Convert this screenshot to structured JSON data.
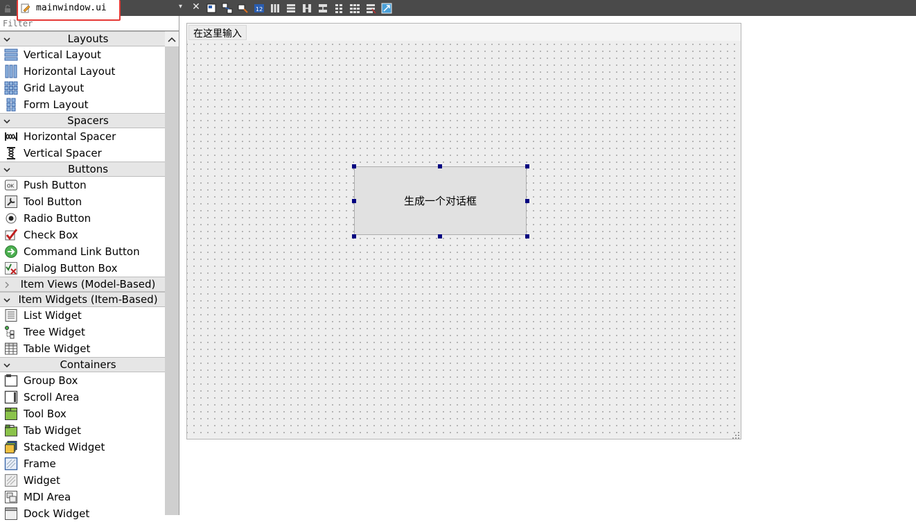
{
  "toolbar": {
    "file_tab": "mainwindow.ui",
    "tab_dropdown": "▾",
    "close_glyph": "✕",
    "tool_icons": [
      "edit-widgets-icon",
      "edit-signals-icon",
      "edit-buddies-icon",
      "edit-tab-order-icon",
      "layout-horizontal-icon",
      "layout-vertical-icon",
      "layout-h-splitter-icon",
      "layout-v-splitter-icon",
      "layout-form-icon",
      "layout-grid-icon",
      "break-layout-icon",
      "adjust-size-icon"
    ]
  },
  "filter": {
    "placeholder": "Filter"
  },
  "widget_box": {
    "categories": [
      {
        "title": "Layouts",
        "expanded": true,
        "items": [
          "Vertical Layout",
          "Horizontal Layout",
          "Grid Layout",
          "Form Layout"
        ]
      },
      {
        "title": "Spacers",
        "expanded": true,
        "items": [
          "Horizontal Spacer",
          "Vertical Spacer"
        ]
      },
      {
        "title": "Buttons",
        "expanded": true,
        "items": [
          "Push Button",
          "Tool Button",
          "Radio Button",
          "Check Box",
          "Command Link Button",
          "Dialog Button Box"
        ]
      },
      {
        "title": "Item Views (Model-Based)",
        "expanded": false,
        "items": []
      },
      {
        "title": "Item Widgets (Item-Based)",
        "expanded": true,
        "items": [
          "List Widget",
          "Tree Widget",
          "Table Widget"
        ]
      },
      {
        "title": "Containers",
        "expanded": true,
        "items": [
          "Group Box",
          "Scroll Area",
          "Tool Box",
          "Tab Widget",
          "Stacked Widget",
          "Frame",
          "Widget",
          "MDI Area",
          "Dock Widget"
        ]
      }
    ]
  },
  "form": {
    "menu_placeholder": "在这里输入",
    "push_button_text": "生成一个对话框"
  },
  "colors": {
    "toolbar_bg": "#4a4a4a",
    "highlight_border": "#e53935",
    "selection_handle": "#000080",
    "category_bg": "#e6e6e6",
    "form_bg": "#eeeeee"
  }
}
